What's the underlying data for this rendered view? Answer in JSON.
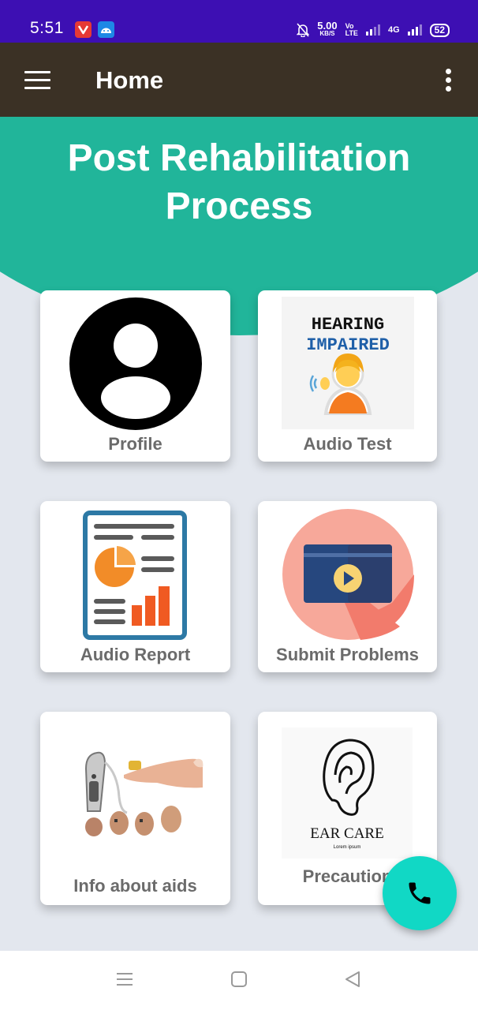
{
  "status_bar": {
    "time": "5:51",
    "speed_value": "5.00",
    "speed_unit": "KB/S",
    "volte_top": "Vo",
    "volte_bottom": "LTE",
    "network": "4G",
    "battery": "52"
  },
  "app_bar": {
    "title": "Home"
  },
  "hero": {
    "title_line1": "Post Rehabilitation",
    "title_line2": "Process"
  },
  "cards": {
    "profile": {
      "label": "Profile"
    },
    "audio_test": {
      "label": "Audio Test",
      "image_text_1": "HEARING",
      "image_text_2": "IMPAIRED"
    },
    "audio_report": {
      "label": "Audio Report"
    },
    "submit_problems": {
      "label": "Submit Problems"
    },
    "info_aids": {
      "label": "Info about aids"
    },
    "precaution": {
      "label": "Precaution",
      "image_text_1": "EAR CARE",
      "image_text_2": "Lorem ipsum"
    }
  },
  "colors": {
    "status_bar": "#3d0fb3",
    "app_bar": "#3b3125",
    "hero": "#21b59a",
    "background": "#e3e7ee",
    "fab": "#11d8c5"
  },
  "icons": {
    "menu": "menu-icon",
    "overflow": "overflow-menu-icon",
    "fab": "phone-icon"
  }
}
